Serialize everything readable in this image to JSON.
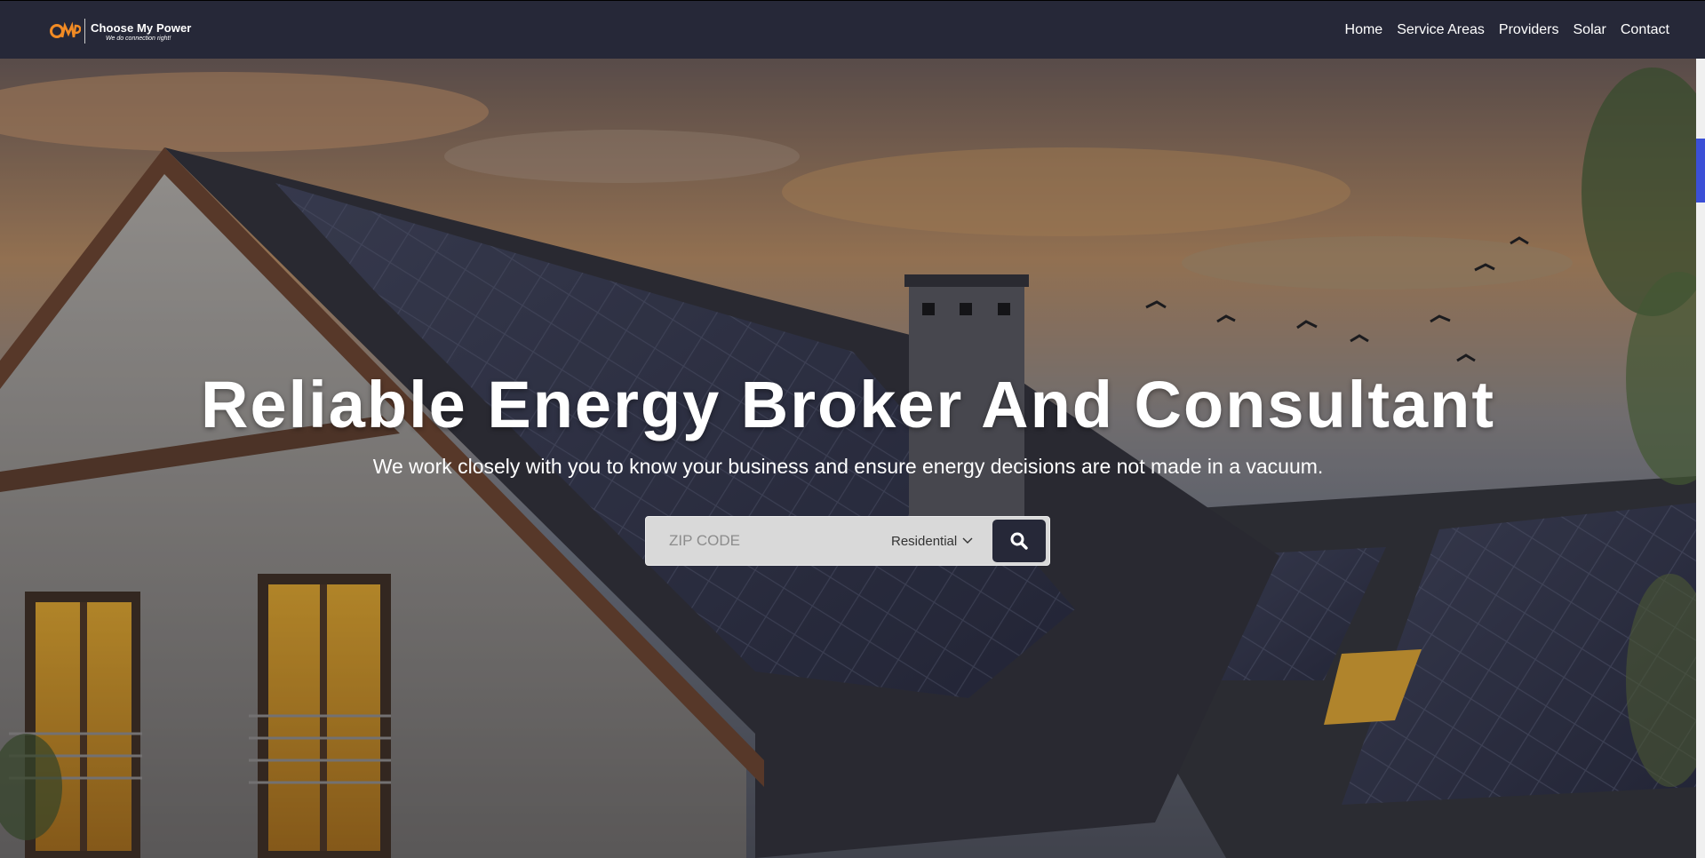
{
  "brand": {
    "name": "Choose My Power",
    "tagline": "We do connection right!",
    "accent_color": "#f28b24"
  },
  "nav": {
    "items": [
      "Home",
      "Service Areas",
      "Providers",
      "Solar",
      "Contact"
    ]
  },
  "hero": {
    "title": "Reliable Energy Broker And Consultant",
    "subtitle": "We work closely with you to know your business and ensure energy decisions are not made in a vacuum.",
    "background": "house-with-solar-panels-at-sunset"
  },
  "search": {
    "zip_placeholder": "ZIP CODE",
    "zip_value": "",
    "service_type": "Residential",
    "button_icon": "search-icon",
    "button_color": "#262838"
  }
}
